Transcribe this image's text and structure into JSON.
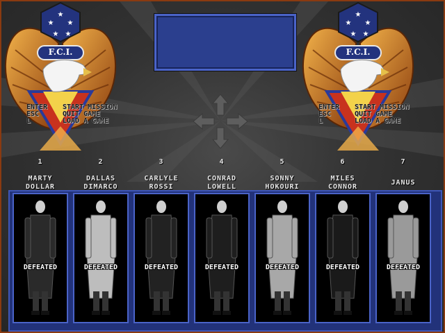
{
  "emblem": {
    "org_label": "F.C.I."
  },
  "controls": [
    {
      "key": "ENTER",
      "action": "START MISSION"
    },
    {
      "key": "ESC",
      "action": "QUIT GAME"
    },
    {
      "key": "L",
      "action": "LOAD A GAME"
    }
  ],
  "agents": [
    {
      "num": "1",
      "name": "MARTY\nDOLLAR",
      "status": "DEFEATED"
    },
    {
      "num": "2",
      "name": "DALLAS\nDIMARCO",
      "status": "DEFEATED"
    },
    {
      "num": "3",
      "name": "CARLYLE\nROSSI",
      "status": "DEFEATED"
    },
    {
      "num": "4",
      "name": "CONRAD\nLOWELL",
      "status": "DEFEATED"
    },
    {
      "num": "5",
      "name": "SONNY\nHOKOURI",
      "status": "DEFEATED"
    },
    {
      "num": "6",
      "name": "MILES\nCONNOR",
      "status": "DEFEATED"
    },
    {
      "num": "7",
      "name": "JANUS",
      "status": "DEFEATED"
    }
  ],
  "colors": {
    "frame": "#8a3a10",
    "panel_blue": "#2b3f8e",
    "wing_gold": "#d98a2a",
    "shield_red": "#c8321e"
  },
  "icons": {
    "dpad": "four-direction-arrows-icon",
    "emblem": "eagle-shield-emblem-icon"
  }
}
